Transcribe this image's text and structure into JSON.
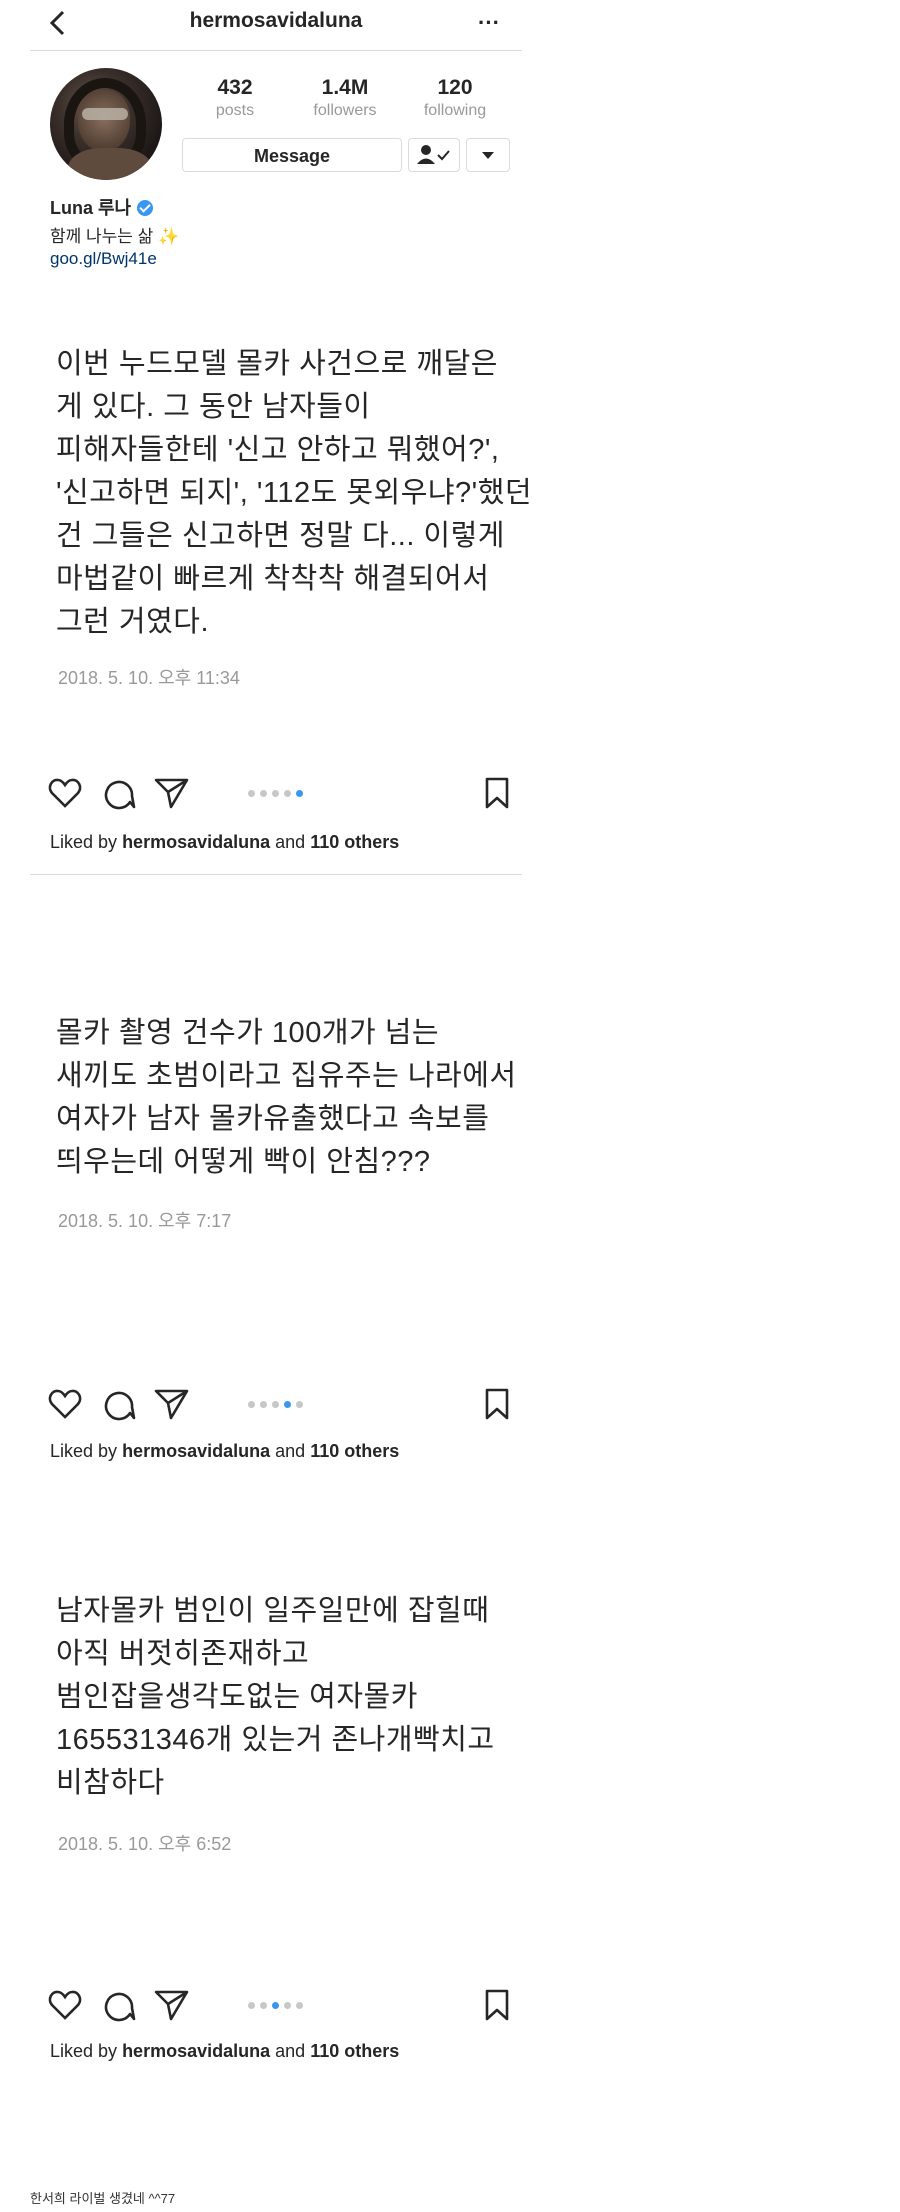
{
  "header": {
    "username": "hermosavidaluna",
    "more": "···"
  },
  "profile": {
    "stats": [
      {
        "num": "432",
        "label": "posts"
      },
      {
        "num": "1.4M",
        "label": "followers"
      },
      {
        "num": "120",
        "label": "following"
      }
    ],
    "message_label": "Message",
    "name": "Luna 루나",
    "bio": "함께 나누는 삶",
    "bio_emoji": "✨",
    "link": "goo.gl/Bwj41e"
  },
  "posts": [
    {
      "text": "이번 누드모델 몰카 사건으로 깨달은\n게 있다. 그 동안 남자들이\n피해자들한테 '신고 안하고 뭐했어?',\n'신고하면 되지', '112도 못외우냐?'했던\n건 그들은 신고하면 정말 다...  이렇게\n마법같이 빠르게 착착착 해결되어서\n그런 거였다.",
      "date": "2018. 5. 10. 오후 11:34",
      "likes_prefix": "Liked by",
      "likes_user": "hermosavidaluna",
      "likes_and": "and",
      "likes_others": "110 others",
      "active_dot": 4
    },
    {
      "text": "몰카 촬영 건수가 100개가 넘는\n새끼도 초범이라고 집유주는 나라에서\n여자가 남자 몰카유출했다고 속보를\n띄우는데 어떻게 빡이 안침???",
      "date": "2018. 5. 10. 오후 7:17",
      "likes_prefix": "Liked by",
      "likes_user": "hermosavidaluna",
      "likes_and": "and",
      "likes_others": "110 others",
      "active_dot": 3
    },
    {
      "text": "남자몰카 범인이 일주일만에 잡힐때\n아직 버젓히존재하고\n범인잡을생각도없는 여자몰카\n165531346개 있는거 존나개빡치고\n비참하다",
      "date": "2018. 5. 10. 오후 6:52",
      "likes_prefix": "Liked by",
      "likes_user": "hermosavidaluna",
      "likes_and": "and",
      "likes_others": "110 others",
      "active_dot": 2
    }
  ],
  "caption": "한서희 라이벌 생겼네 ^^77",
  "colors": {
    "accent": "#3897f0",
    "link": "#003569",
    "muted": "#999999",
    "border": "#dbdbdb"
  }
}
